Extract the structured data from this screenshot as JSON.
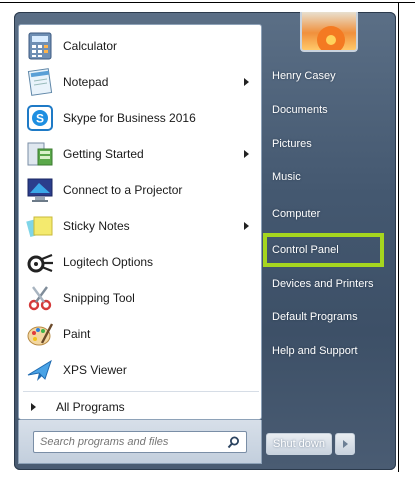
{
  "start_menu": {
    "programs": [
      {
        "label": "Calculator",
        "icon": "calculator-icon",
        "submenu": false
      },
      {
        "label": "Notepad",
        "icon": "notepad-icon",
        "submenu": true
      },
      {
        "label": "Skype for Business 2016",
        "icon": "skype-icon",
        "submenu": false
      },
      {
        "label": "Getting Started",
        "icon": "getting-started-icon",
        "submenu": true
      },
      {
        "label": "Connect to a Projector",
        "icon": "projector-icon",
        "submenu": false
      },
      {
        "label": "Sticky Notes",
        "icon": "sticky-notes-icon",
        "submenu": true
      },
      {
        "label": "Logitech Options",
        "icon": "logitech-icon",
        "submenu": false
      },
      {
        "label": "Snipping Tool",
        "icon": "scissors-icon",
        "submenu": false
      },
      {
        "label": "Paint",
        "icon": "paint-palette-icon",
        "submenu": false
      },
      {
        "label": "XPS Viewer",
        "icon": "xps-viewer-icon",
        "submenu": false
      }
    ],
    "all_programs_label": "All Programs",
    "search": {
      "placeholder": "Search programs and files"
    },
    "right_links": [
      {
        "label": "Henry Casey"
      },
      {
        "label": "Documents"
      },
      {
        "label": "Pictures"
      },
      {
        "label": "Music"
      },
      {
        "label": "Computer"
      },
      {
        "label": "Control Panel"
      },
      {
        "label": "Devices and Printers"
      },
      {
        "label": "Default Programs"
      },
      {
        "label": "Help and Support"
      }
    ],
    "shutdown_label": "Shut down",
    "highlight_color": "#a6d61e"
  }
}
